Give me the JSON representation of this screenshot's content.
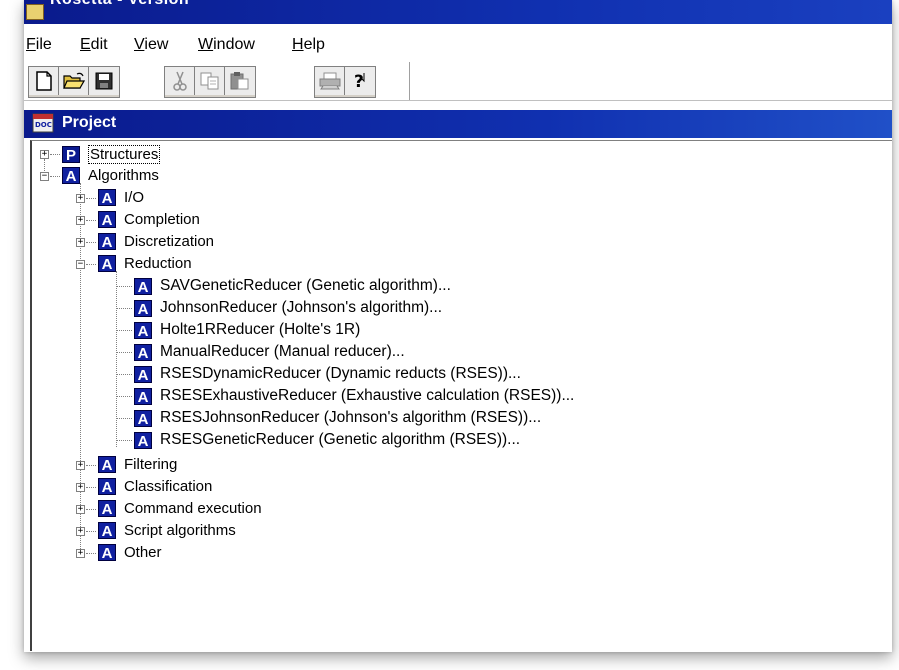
{
  "window": {
    "title": "Rosetta - Version"
  },
  "menu": [
    {
      "label": "File",
      "u": "F",
      "rest": "ile"
    },
    {
      "label": "Edit",
      "u": "E",
      "rest": "dit"
    },
    {
      "label": "View",
      "u": "V",
      "rest": "iew"
    },
    {
      "label": "Window",
      "u": "W",
      "rest": "indow"
    },
    {
      "label": "Help",
      "u": "H",
      "rest": "elp"
    }
  ],
  "toolbar": {
    "buttons": [
      "new-icon",
      "open-folder-icon",
      "save-icon",
      "cut-icon",
      "copy-icon",
      "paste-icon",
      "print-icon",
      "help-icon"
    ]
  },
  "project": {
    "title": "Project"
  },
  "tree": {
    "structures": {
      "badge": "P",
      "label": "Structures"
    },
    "algorithms": {
      "badge": "A",
      "label": "Algorithms"
    },
    "categories": [
      {
        "badge": "A",
        "label": "I/O"
      },
      {
        "badge": "A",
        "label": "Completion"
      },
      {
        "badge": "A",
        "label": "Discretization"
      },
      {
        "badge": "A",
        "label": "Reduction"
      },
      {
        "badge": "A",
        "label": "Filtering"
      },
      {
        "badge": "A",
        "label": "Classification"
      },
      {
        "badge": "A",
        "label": "Command execution"
      },
      {
        "badge": "A",
        "label": "Script algorithms"
      },
      {
        "badge": "A",
        "label": "Other"
      }
    ],
    "reducers": [
      {
        "badge": "A",
        "label": "SAVGeneticReducer (Genetic algorithm)..."
      },
      {
        "badge": "A",
        "label": "JohnsonReducer (Johnson's algorithm)..."
      },
      {
        "badge": "A",
        "label": "Holte1RReducer (Holte's 1R)"
      },
      {
        "badge": "A",
        "label": "ManualReducer (Manual reducer)..."
      },
      {
        "badge": "A",
        "label": "RSESDynamicReducer (Dynamic reducts (RSES))..."
      },
      {
        "badge": "A",
        "label": "RSESExhaustiveReducer (Exhaustive calculation (RSES))..."
      },
      {
        "badge": "A",
        "label": "RSESJohnsonReducer (Johnson's algorithm (RSES))..."
      },
      {
        "badge": "A",
        "label": "RSESGeneticReducer (Genetic algorithm (RSES))..."
      }
    ]
  },
  "colors": {
    "title_blue": "#0a1a8c",
    "badge_blue": "#1020a0"
  }
}
